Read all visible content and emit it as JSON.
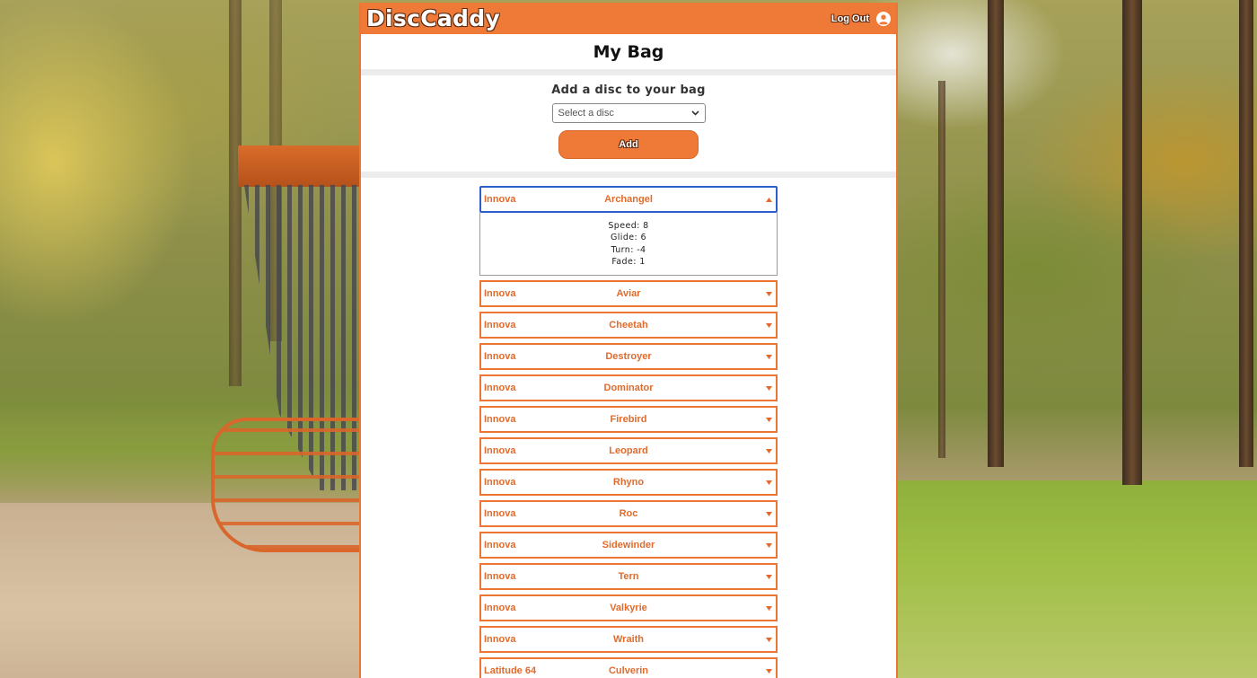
{
  "colors": {
    "accent": "#ef7936",
    "accent_text": "#e06b2c",
    "focus": "#2c5fc9"
  },
  "nav": {
    "logo": "DiscCaddy",
    "logout_label": "Log Out",
    "user_icon": "user-circle-icon"
  },
  "page": {
    "title": "My Bag"
  },
  "add_disc": {
    "heading": "Add a disc to your bag",
    "select_value": "Select a disc",
    "button_label": "Add"
  },
  "bag": {
    "open": {
      "brand": "Innova",
      "name": "Archangel",
      "speed": "Speed: 8",
      "glide": "Glide: 6",
      "turn": "Turn: -4",
      "fade": "Fade: 1"
    },
    "discs": [
      {
        "brand": "Innova",
        "name": "Aviar"
      },
      {
        "brand": "Innova",
        "name": "Cheetah"
      },
      {
        "brand": "Innova",
        "name": "Destroyer"
      },
      {
        "brand": "Innova",
        "name": "Dominator"
      },
      {
        "brand": "Innova",
        "name": "Firebird"
      },
      {
        "brand": "Innova",
        "name": "Leopard"
      },
      {
        "brand": "Innova",
        "name": "Rhyno"
      },
      {
        "brand": "Innova",
        "name": "Roc"
      },
      {
        "brand": "Innova",
        "name": "Sidewinder"
      },
      {
        "brand": "Innova",
        "name": "Tern"
      },
      {
        "brand": "Innova",
        "name": "Valkyrie"
      },
      {
        "brand": "Innova",
        "name": "Wraith"
      },
      {
        "brand": "Latitude 64",
        "name": "Culverin"
      }
    ]
  }
}
